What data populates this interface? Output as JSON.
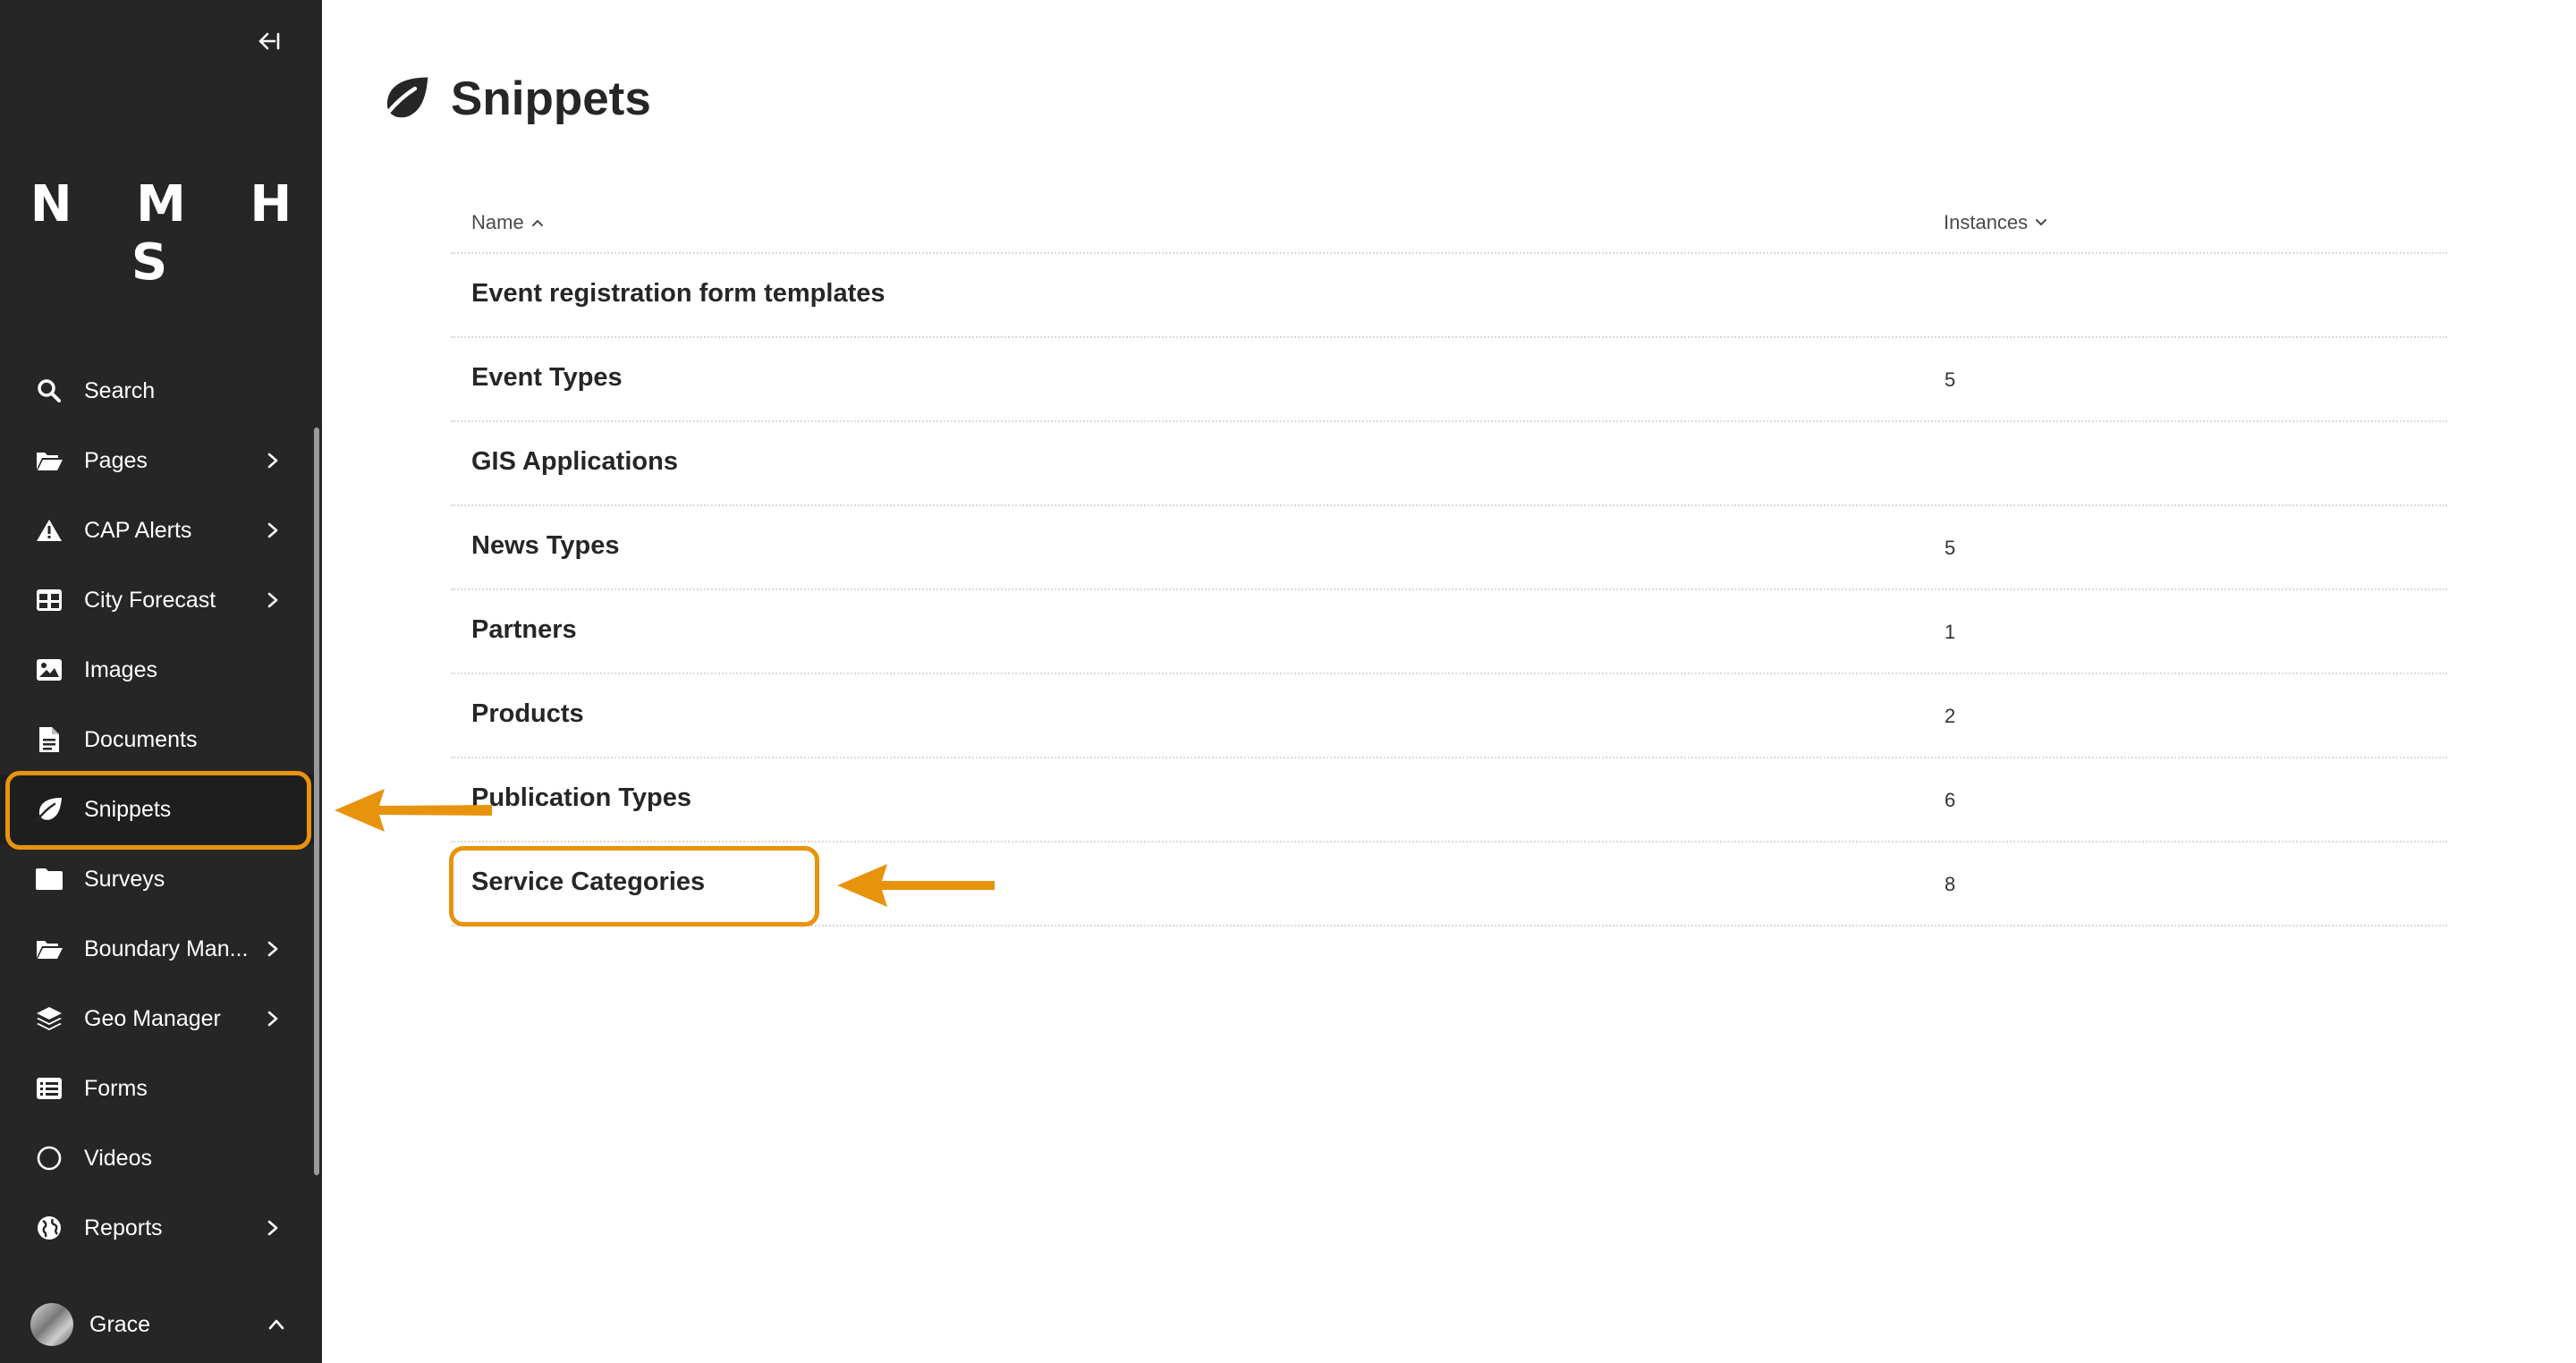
{
  "sidebar": {
    "logo": "N M H S",
    "items": [
      {
        "label": "Search",
        "icon": "search-icon",
        "has_submenu": false
      },
      {
        "label": "Pages",
        "icon": "folder-open-icon",
        "has_submenu": true
      },
      {
        "label": "CAP Alerts",
        "icon": "warning-icon",
        "has_submenu": true
      },
      {
        "label": "City Forecast",
        "icon": "table-icon",
        "has_submenu": true
      },
      {
        "label": "Images",
        "icon": "image-icon",
        "has_submenu": false
      },
      {
        "label": "Documents",
        "icon": "document-icon",
        "has_submenu": false
      },
      {
        "label": "Snippets",
        "icon": "leaf-icon",
        "has_submenu": false,
        "active": true
      },
      {
        "label": "Surveys",
        "icon": "folder-icon",
        "has_submenu": false
      },
      {
        "label": "Boundary Man...",
        "icon": "folder-open-icon",
        "has_submenu": true
      },
      {
        "label": "Geo Manager",
        "icon": "layers-icon",
        "has_submenu": true
      },
      {
        "label": "Forms",
        "icon": "list-icon",
        "has_submenu": false
      },
      {
        "label": "Videos",
        "icon": "circle-icon",
        "has_submenu": false
      },
      {
        "label": "Reports",
        "icon": "globe-icon",
        "has_submenu": true
      }
    ],
    "account": {
      "name": "Grace"
    }
  },
  "main": {
    "title": "Snippets",
    "table": {
      "headers": {
        "name": "Name",
        "instances": "Instances"
      },
      "rows": [
        {
          "name": "Event registration form templates",
          "instances": ""
        },
        {
          "name": "Event Types",
          "instances": "5"
        },
        {
          "name": "GIS Applications",
          "instances": ""
        },
        {
          "name": "News Types",
          "instances": "5"
        },
        {
          "name": "Partners",
          "instances": "1"
        },
        {
          "name": "Products",
          "instances": "2"
        },
        {
          "name": "Publication Types",
          "instances": "6"
        },
        {
          "name": "Service Categories",
          "instances": "8"
        }
      ]
    }
  },
  "colors": {
    "sidebar_bg": "#262626",
    "highlight": "#e8930c",
    "text": "#262626"
  }
}
